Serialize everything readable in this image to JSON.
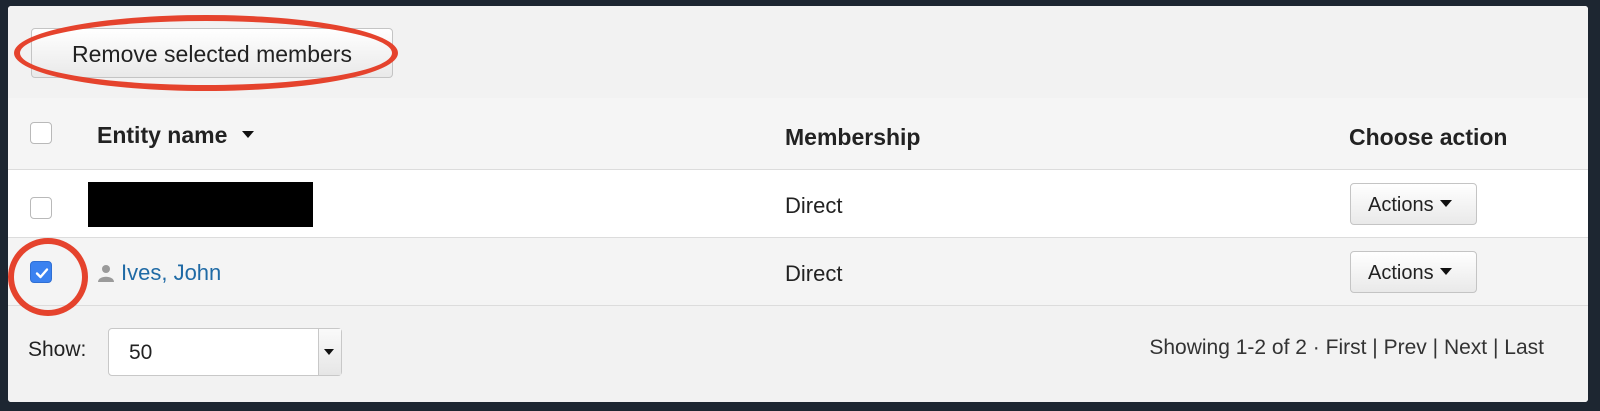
{
  "toolbar": {
    "remove_button_label": "Remove selected members"
  },
  "table": {
    "columns": {
      "entity_name": "Entity name",
      "membership": "Membership",
      "choose_action": "Choose action"
    },
    "rows": [
      {
        "checked": false,
        "name": "",
        "name_redacted": true,
        "membership": "Direct",
        "action_label": "Actions"
      },
      {
        "checked": true,
        "name": "Ives, John",
        "name_redacted": false,
        "membership": "Direct",
        "action_label": "Actions"
      }
    ]
  },
  "footer": {
    "show_label": "Show:",
    "page_size": "50",
    "showing_text": "Showing 1-2 of 2 ·",
    "pager": {
      "first": "First",
      "prev": "Prev",
      "next": "Next",
      "last": "Last",
      "separator": "|"
    }
  },
  "colors": {
    "annotation": "#e5432d",
    "link": "#1f6aa5",
    "checkbox_checked": "#3b82f0"
  },
  "icons": {
    "sort": "caret-down-icon",
    "user": "user-icon",
    "dropdown": "caret-down-icon"
  }
}
